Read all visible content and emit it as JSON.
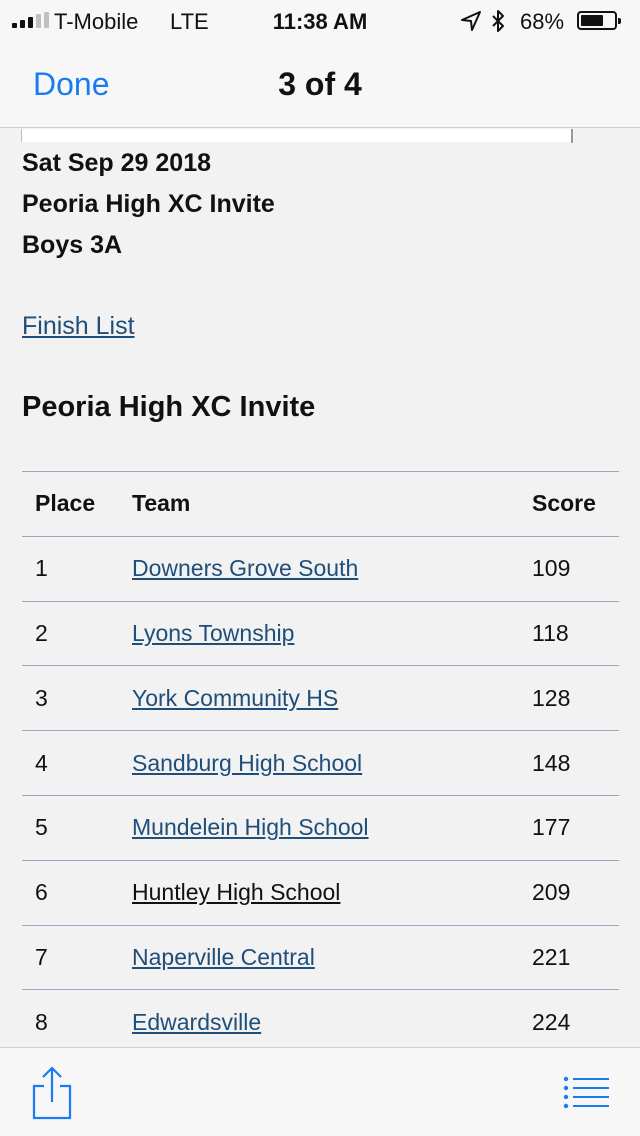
{
  "status_bar": {
    "carrier": "T-Mobile",
    "network": "LTE",
    "time": "11:38 AM",
    "battery": "68%",
    "battery_level": 0.68,
    "signal_bars_filled": 3,
    "signal_bars_total": 5,
    "icons": [
      "location-arrow-icon",
      "bluetooth-icon",
      "battery-icon"
    ]
  },
  "nav": {
    "done_label": "Done",
    "page_counter": "3 of 4"
  },
  "document": {
    "date": "Sat Sep 29 2018",
    "meet": "Peoria High XC Invite",
    "division": "Boys 3A",
    "finish_link": "Finish List",
    "section_title": "Peoria High XC Invite",
    "table": {
      "headers": [
        "Place",
        "Team",
        "Score"
      ],
      "rows": [
        {
          "place": "1",
          "team": "Downers Grove South",
          "score": "109"
        },
        {
          "place": "2",
          "team": "Lyons Township",
          "score": "118"
        },
        {
          "place": "3",
          "team": "York Community HS",
          "score": "128"
        },
        {
          "place": "4",
          "team": "Sandburg High School",
          "score": "148"
        },
        {
          "place": "5",
          "team": "Mundelein High School",
          "score": "177"
        },
        {
          "place": "6",
          "team": "Huntley High School",
          "score": "209"
        },
        {
          "place": "7",
          "team": "Naperville Central",
          "score": "221"
        },
        {
          "place": "8",
          "team": "Edwardsville",
          "score": "224"
        }
      ]
    }
  },
  "toolbar": {
    "icons": [
      "share-icon",
      "list-icon"
    ]
  },
  "colors": {
    "accent": "#1a7cf2",
    "link": "#1f4e79",
    "table_rule": "#9aa9c2"
  }
}
